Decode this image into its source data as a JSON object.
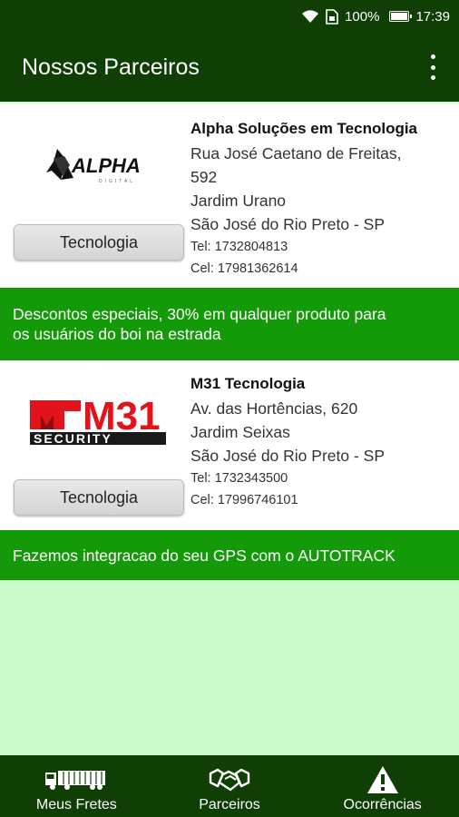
{
  "status_bar": {
    "battery_percent": "100%",
    "time": "17:39"
  },
  "app_bar": {
    "title": "Nossos Parceiros",
    "menu_icon": "overflow-menu-icon"
  },
  "partners": [
    {
      "name": "Alpha Soluções em Tecnologia",
      "address_line1": "Rua José Caetano de Freitas,",
      "address_line2": "592",
      "neighborhood": "Jardim Urano",
      "city": "São José do Rio Preto - SP",
      "tel": "Tel: 1732804813",
      "cel": "Cel: 17981362614",
      "category": "Tecnologia",
      "logo_text": "ALPHA",
      "logo_subtext": "DIGITAL",
      "promo_line1": "Descontos especiais, 30% em qualquer produto para",
      "promo_line2": "os usuários do boi na estrada"
    },
    {
      "name": "M31 Tecnologia",
      "address_line1": "Av. das Hortências, 620",
      "neighborhood": "Jardim Seixas",
      "city": "São José do Rio Preto - SP",
      "tel": "Tel: 1732343500",
      "cel": "Cel: 17996746101",
      "category": "Tecnologia",
      "logo_text": "M31",
      "logo_subtext": "SECURITY",
      "promo_line1": "Fazemos integracao do seu GPS com o AUTOTRACK"
    }
  ],
  "bottom_nav": [
    {
      "label": "Meus Fretes",
      "icon": "truck-icon"
    },
    {
      "label": "Parceiros",
      "icon": "handshake-icon"
    },
    {
      "label": "Ocorrências",
      "icon": "warning-icon"
    }
  ],
  "colors": {
    "dark_green": "#0f3f04",
    "promo_green": "#149a08",
    "background": "#cdfbcd"
  }
}
